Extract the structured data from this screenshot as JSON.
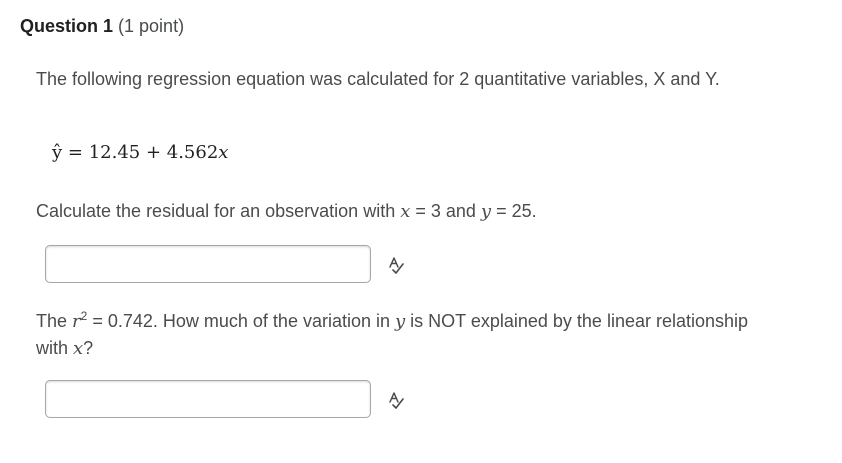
{
  "question": {
    "title": "Question 1",
    "points": "(1 point)"
  },
  "intro": {
    "text": "The following regression equation was calculated for 2 quantitative variables, X and Y."
  },
  "equation": {
    "lhs": "ŷ",
    "equals": " = ",
    "rhs_const": "12.45 + 4.562",
    "rhs_var": "x"
  },
  "part1": {
    "prefix": "Calculate the residual for an observation with ",
    "var_x": "x",
    "mid1": " = 3 and ",
    "var_y": "y",
    "suffix": " = 25."
  },
  "part2": {
    "prefix": "The ",
    "var_r": "r",
    "exponent": "2",
    "mid1": " = 0.742.  How much of the variation in ",
    "var_y": "y",
    "mid2": " is NOT explained by the linear relationship with ",
    "var_x": "x",
    "suffix": "?"
  },
  "answers": [
    {
      "value": "",
      "placeholder": ""
    },
    {
      "value": "",
      "placeholder": ""
    }
  ],
  "icons": {
    "spellcheck": "spellcheck-icon"
  },
  "colors": {
    "text": "#494c4e",
    "heading": "#202122",
    "input_border": "#a4a7aa"
  }
}
